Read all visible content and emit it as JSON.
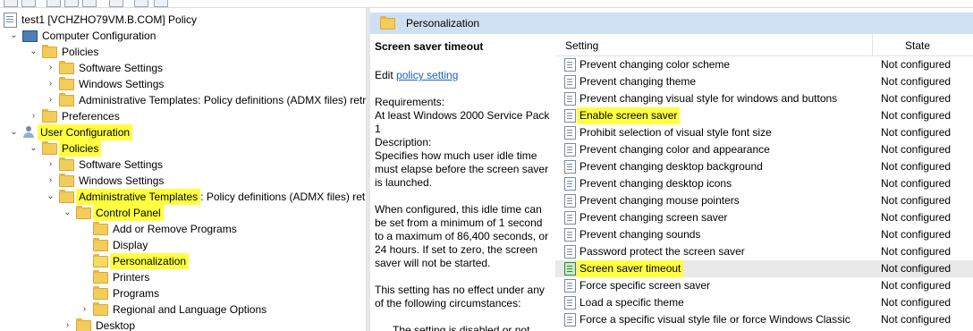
{
  "tree": {
    "root": "test1 [VCHZHO79VM.B.COM] Policy",
    "computer_configuration": "Computer Configuration",
    "cc_policies": "Policies",
    "cc_software_settings": "Software Settings",
    "cc_windows_settings": "Windows Settings",
    "cc_admin_templates": "Administrative Templates: Policy definitions (ADMX files) retr",
    "cc_preferences": "Preferences",
    "user_configuration": "User Configuration",
    "uc_policies": "Policies",
    "uc_software_settings": "Software Settings",
    "uc_windows_settings": "Windows Settings",
    "uc_admin_templates_hl": "Administrative Templates",
    "uc_admin_templates_rest": ": Policy definitions (ADMX files) retr",
    "control_panel": "Control Panel",
    "add_remove_programs": "Add or Remove Programs",
    "display": "Display",
    "personalization": "Personalization",
    "printers": "Printers",
    "programs": "Programs",
    "regional": "Regional and Language Options",
    "desktop": "Desktop"
  },
  "header": {
    "title": "Personalization"
  },
  "description": {
    "title": "Screen saver timeout",
    "edit_prefix": "Edit ",
    "edit_link": "policy setting ",
    "requirements_label": "Requirements:",
    "requirements_value": "At least Windows 2000 Service Pack 1",
    "description_label": "Description:",
    "para1": "Specifies how much user idle time must elapse before the screen saver is launched.",
    "para2": "When configured, this idle time can be set from a minimum of 1 second to a maximum of 86,400 seconds, or 24 hours. If set to zero, the screen saver will not be started.",
    "para3": "This setting has no effect under any of the following circumstances:",
    "para4": "The setting is disabled or not"
  },
  "list": {
    "col_setting": "Setting",
    "col_state": "State",
    "rows": [
      {
        "name": "Prevent changing color scheme",
        "state": "Not configured"
      },
      {
        "name": "Prevent changing theme",
        "state": "Not configured"
      },
      {
        "name": "Prevent changing visual style for windows and buttons",
        "state": "Not configured"
      },
      {
        "name": "Enable screen saver",
        "state": "Not configured"
      },
      {
        "name": "Prohibit selection of visual style font size",
        "state": "Not configured"
      },
      {
        "name": "Prevent changing color and appearance",
        "state": "Not configured"
      },
      {
        "name": "Prevent changing desktop background",
        "state": "Not configured"
      },
      {
        "name": "Prevent changing desktop icons",
        "state": "Not configured"
      },
      {
        "name": "Prevent changing mouse pointers",
        "state": "Not configured"
      },
      {
        "name": "Prevent changing screen saver",
        "state": "Not configured"
      },
      {
        "name": "Prevent changing sounds",
        "state": "Not configured"
      },
      {
        "name": "Password protect the screen saver",
        "state": "Not configured"
      },
      {
        "name": "Screen saver timeout",
        "state": "Not configured"
      },
      {
        "name": "Force specific screen saver",
        "state": "Not configured"
      },
      {
        "name": "Load a specific theme",
        "state": "Not configured"
      },
      {
        "name": "Force a specific visual style file or force Windows Classic",
        "state": "Not configured"
      }
    ]
  },
  "colors": {
    "highlight": "#ffff40",
    "header_bg": "#cfe0f3",
    "link": "#1f5fbf"
  }
}
